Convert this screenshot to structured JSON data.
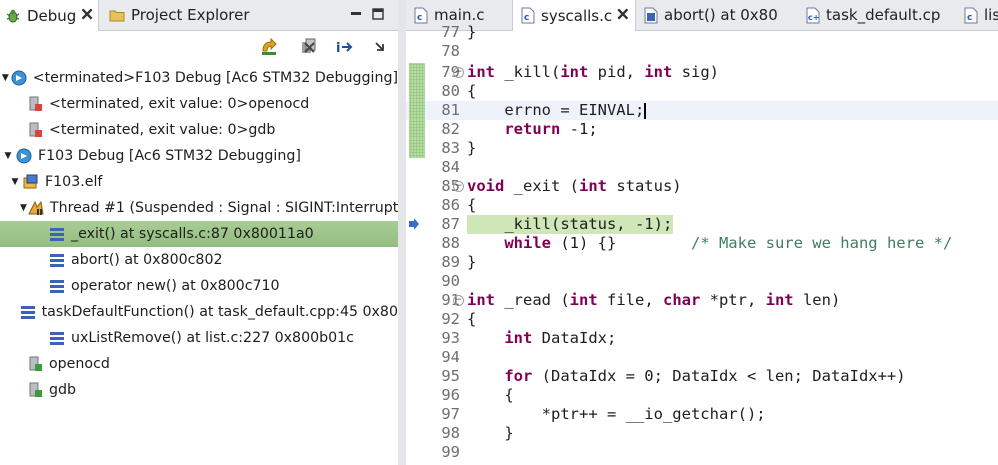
{
  "left_panel": {
    "tabs": [
      {
        "label": "Debug",
        "active": true,
        "close": "🗙"
      },
      {
        "label": "Project Explorer",
        "active": false
      }
    ],
    "tree": [
      {
        "label": "<terminated>F103 Debug [Ac6 STM32 Debugging]",
        "icon": "launch-icon"
      },
      {
        "label": "<terminated, exit value: 0>openocd",
        "icon": "process-terminated-icon"
      },
      {
        "label": "<terminated, exit value: 0>gdb",
        "icon": "process-terminated-icon"
      },
      {
        "label": "F103 Debug [Ac6 STM32 Debugging]",
        "icon": "launch-icon"
      },
      {
        "label": "F103.elf",
        "icon": "debug-target-icon"
      },
      {
        "label": "Thread #1 (Suspended : Signal : SIGINT:Interrupt)",
        "icon": "thread-suspended-icon"
      },
      {
        "label": "_exit() at syscalls.c:87 0x80011a0",
        "icon": "stack-frame-icon",
        "selected": true
      },
      {
        "label": "abort() at 0x800c802",
        "icon": "stack-frame-icon"
      },
      {
        "label": "operator new() at 0x800c710",
        "icon": "stack-frame-icon"
      },
      {
        "label": "taskDefaultFunction() at task_default.cpp:45 0x80",
        "icon": "stack-frame-icon"
      },
      {
        "label": "uxListRemove() at list.c:227 0x800b01c",
        "icon": "stack-frame-icon"
      },
      {
        "label": "openocd",
        "icon": "process-icon"
      },
      {
        "label": "gdb",
        "icon": "process-icon"
      }
    ]
  },
  "editor": {
    "tabs": [
      {
        "label": "main.c"
      },
      {
        "label": "syscalls.c",
        "active": true,
        "close": "🗙"
      },
      {
        "label": "abort() at 0x80"
      },
      {
        "label": "task_default.cp"
      },
      {
        "label": "lis"
      }
    ],
    "lines": [
      {
        "num": "77",
        "text": "}"
      },
      {
        "num": "78",
        "text": ""
      },
      {
        "num": "79",
        "text": "int _kill(int pid, int sig)"
      },
      {
        "num": "80",
        "text": "{"
      },
      {
        "num": "81",
        "text": "    errno = EINVAL;"
      },
      {
        "num": "82",
        "text": "    return -1;"
      },
      {
        "num": "83",
        "text": "}"
      },
      {
        "num": "84",
        "text": ""
      },
      {
        "num": "85",
        "text": "void _exit (int status)"
      },
      {
        "num": "86",
        "text": "{"
      },
      {
        "num": "87",
        "text": "    _kill(status, -1);"
      },
      {
        "num": "88",
        "text": "    while (1) {}        /* Make sure we hang here */"
      },
      {
        "num": "89",
        "text": "}"
      },
      {
        "num": "90",
        "text": ""
      },
      {
        "num": "91",
        "text": "int _read (int file, char *ptr, int len)"
      },
      {
        "num": "92",
        "text": "{"
      },
      {
        "num": "93",
        "text": "    int DataIdx;"
      },
      {
        "num": "94",
        "text": ""
      },
      {
        "num": "95",
        "text": "    for (DataIdx = 0; DataIdx < len; DataIdx++)"
      },
      {
        "num": "96",
        "text": "    {"
      },
      {
        "num": "97",
        "text": "        *ptr++ = __io_getchar();"
      },
      {
        "num": "98",
        "text": "    }"
      },
      {
        "num": "99",
        "text": ""
      }
    ]
  },
  "colors": {
    "selection": "#9dc48a",
    "current_line_highlight": "#cfe6b8",
    "keyword": "#7f0055",
    "comment": "#3f7f5f"
  }
}
